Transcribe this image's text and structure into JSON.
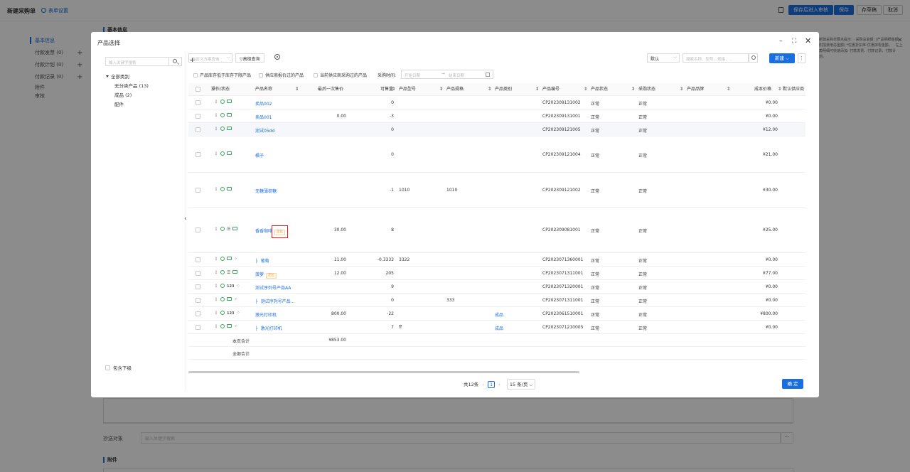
{
  "background": {
    "page_title": "新建采购单",
    "form_settings": "表单设置",
    "buttons": {
      "save_enter_review": "保存后进入审核",
      "save": "保存",
      "save_draft": "存草稿",
      "cancel": "取消"
    },
    "nav": [
      {
        "label": "基本信息",
        "active": true
      },
      {
        "label": "付款发票 (0)",
        "plus": "+"
      },
      {
        "label": "付款计划 (0)",
        "plus": "+"
      },
      {
        "label": "付款记录 (0)",
        "plus": "+"
      },
      {
        "label": "附件"
      },
      {
        "label": "审核"
      }
    ],
    "section_basic": "基本信息",
    "section_attach": "附件",
    "right_note": "新建采购单要点提示: · 采购总金额: (产品明细金额-附加费用总金额) *优惠折扣率-优惠抹零金额。 · 左上角明细可快速添加: 付款发票、付款记录、付款计划。",
    "right_close": "✕",
    "cc_label": "抄送对象",
    "cc_placeholder": "输入关键字搜索",
    "cc_more": "···"
  },
  "modal": {
    "title": "产品选择",
    "minimize": "–",
    "maximize": "⛶",
    "close": "✕",
    "tree_search_placeholder": "输入关键字搜索",
    "tree_add": "+",
    "tree": {
      "root": "全部类别",
      "children": [
        "无分类产品 (13)",
        "成品 (2)",
        "配件"
      ]
    },
    "include_sub": "包含下级",
    "collapse": "‹",
    "toolbar": {
      "scheme_placeholder": "自定义方案查询",
      "advanced": "高级查询",
      "sort_value": "默认",
      "search_placeholder": "搜索名称、型号、规格、...",
      "new_btn": "新建",
      "more": "⋮"
    },
    "filters": {
      "f1": "产品库存低于库存下限产品",
      "f2": "供应商报价过的产品",
      "f3": "当前供应商采购过的产品",
      "purchase_time_label": "采购时间:",
      "start_placeholder": "开始日期",
      "arrow": "→",
      "end_placeholder": "结束日期"
    },
    "columns": [
      "操作/状态",
      "产品名称",
      "最后一次售价",
      "可售量",
      "产品型号",
      "产品规格",
      "产品类别",
      "产品编号",
      "产品状态",
      "采购状态",
      "产品品牌",
      "成本价格",
      "默认供应商"
    ],
    "rows": [
      {
        "name": "卖品002",
        "last_price": "",
        "qty": "0",
        "model": "",
        "spec": "",
        "category": "",
        "code": "CP202309131002",
        "status": "正常",
        "purchase_status": "正常",
        "cost": "¥0.00",
        "tag": "",
        "branch": false
      },
      {
        "name": "卖品001",
        "last_price": "0.00",
        "qty": "-3",
        "model": "",
        "spec": "",
        "category": "",
        "code": "CP202309131001",
        "status": "正常",
        "purchase_status": "正常",
        "cost": "¥0.00",
        "tag": "",
        "branch": false
      },
      {
        "name": "测试05dd",
        "last_price": "",
        "qty": "0",
        "model": "",
        "spec": "",
        "category": "",
        "code": "CP202309121005",
        "status": "正常",
        "purchase_status": "正常",
        "cost": "¥12.00",
        "tag": "",
        "branch": false
      },
      {
        "name": "橘子",
        "last_price": "",
        "qty": "0",
        "model": "",
        "spec": "",
        "category": "",
        "code": "CP202309121004",
        "status": "正常",
        "purchase_status": "正常",
        "cost": "¥21.00",
        "tag": "",
        "branch": false
      },
      {
        "name": "无糖薄荷糖",
        "last_price": "",
        "qty": "-1",
        "model": "1010",
        "spec": "1010",
        "category": "",
        "code": "CP202309121002",
        "status": "正常",
        "purchase_status": "正常",
        "cost": "¥30.00",
        "tag": "",
        "branch": false
      },
      {
        "name": "香香咖啡",
        "last_price": "30.00",
        "qty": "8",
        "model": "",
        "spec": "",
        "category": "",
        "code": "CP202309081001",
        "status": "正常",
        "purchase_status": "正常",
        "cost": "¥25.00",
        "tag": "定位",
        "branch": false
      },
      {
        "name": "葡萄",
        "last_price": "11.00",
        "qty": "-0.3333",
        "model": "3322",
        "spec": "",
        "category": "",
        "code": "CP2023071360001",
        "status": "正常",
        "purchase_status": "正常",
        "cost": "¥0.00",
        "tag": "",
        "branch": true
      },
      {
        "name": "菠萝",
        "last_price": "12.00",
        "qty": "205",
        "model": "",
        "spec": "",
        "category": "",
        "code": "CP2023071311001",
        "status": "正常",
        "purchase_status": "正常",
        "cost": "¥77.00",
        "tag": "定位",
        "branch": false
      },
      {
        "name": "测试序列号产品AA",
        "last_price": "",
        "qty": "9",
        "model": "",
        "spec": "",
        "category": "",
        "code": "CP2023071320001",
        "status": "正常",
        "purchase_status": "正常",
        "cost": "¥0.00",
        "tag": "",
        "branch": false
      },
      {
        "name": "测试序列号产品...",
        "last_price": "",
        "qty": "0",
        "model": "",
        "spec": "333",
        "category": "",
        "code": "CP2023071311001",
        "status": "正常",
        "purchase_status": "正常",
        "cost": "¥0.00",
        "tag": "",
        "branch": true
      },
      {
        "name": "激光打印机",
        "last_price": "800.00",
        "qty": "-22",
        "model": "",
        "spec": "",
        "category": "成品",
        "code": "CP2023061510001",
        "status": "正常",
        "purchase_status": "正常",
        "cost": "¥800.00",
        "tag": "",
        "branch": false
      },
      {
        "name": "激光打印机",
        "last_price": "",
        "qty": "7",
        "model": "ff",
        "spec": "",
        "category": "成品",
        "code": "CP2023071210005",
        "status": "正常",
        "purchase_status": "正常",
        "cost": "¥0.00",
        "tag": "",
        "branch": true
      }
    ],
    "summary": {
      "page_total_label": "本页合计",
      "page_total_value": "¥853.00",
      "all_total_label": "全部合计"
    },
    "pager": {
      "total": "共12条",
      "prev": "‹",
      "page": "1",
      "next": "›",
      "size": "15 条/页"
    },
    "confirm": "确 定"
  }
}
